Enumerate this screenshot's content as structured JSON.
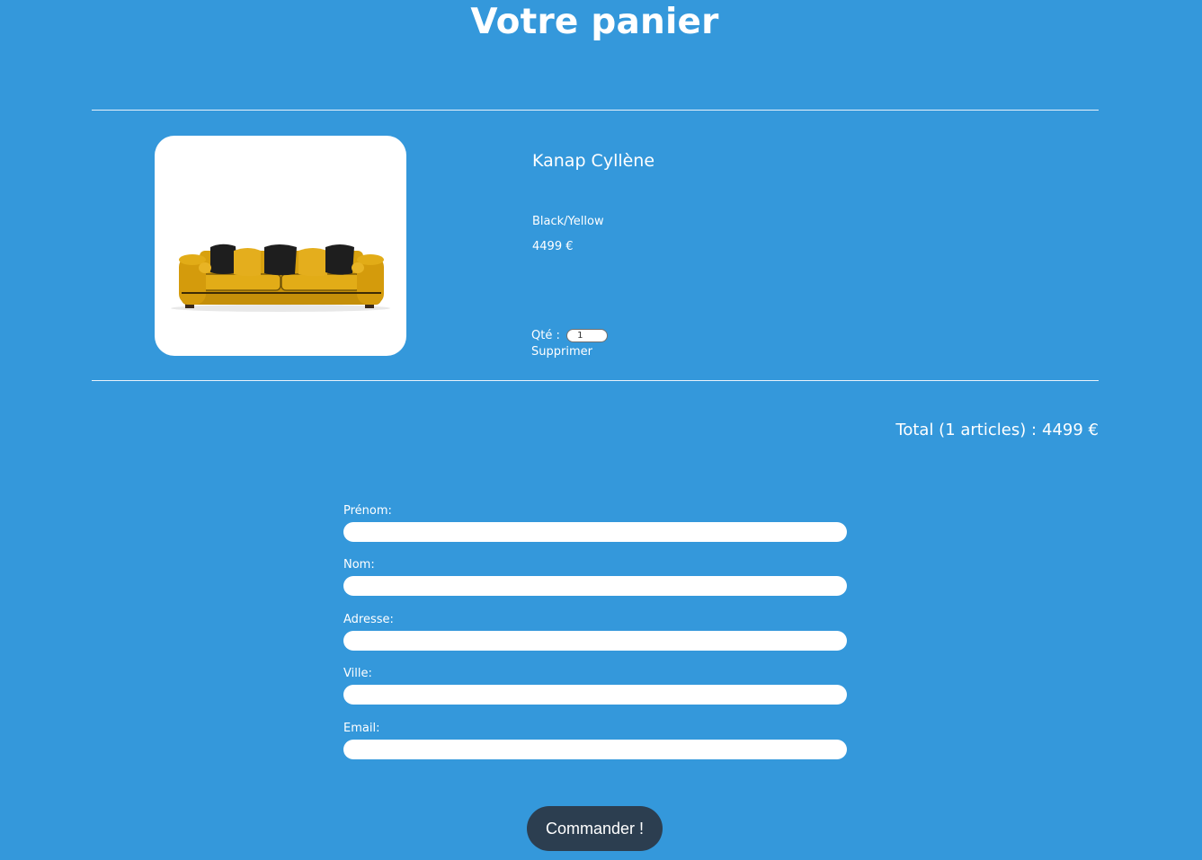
{
  "page": {
    "title": "Votre panier"
  },
  "cart": {
    "items": [
      {
        "name": "Kanap Cyllène",
        "color": "Black/Yellow",
        "price": "4499 €",
        "quantity_label": "Qté :",
        "quantity": "1",
        "delete_label": "Supprimer",
        "image": "yellow-sofa-with-black-cushions"
      }
    ],
    "total_label": "Total (1 articles) :",
    "total_price": "4499 €"
  },
  "form": {
    "first_name_label": "Prénom:",
    "last_name_label": "Nom:",
    "address_label": "Adresse:",
    "city_label": "Ville:",
    "email_label": "Email:",
    "first_name_value": "",
    "last_name_value": "",
    "address_value": "",
    "city_value": "",
    "email_value": "",
    "submit_label": "Commander !"
  },
  "colors": {
    "background": "#3498db",
    "button": "#2c3e50",
    "text": "#ffffff"
  }
}
